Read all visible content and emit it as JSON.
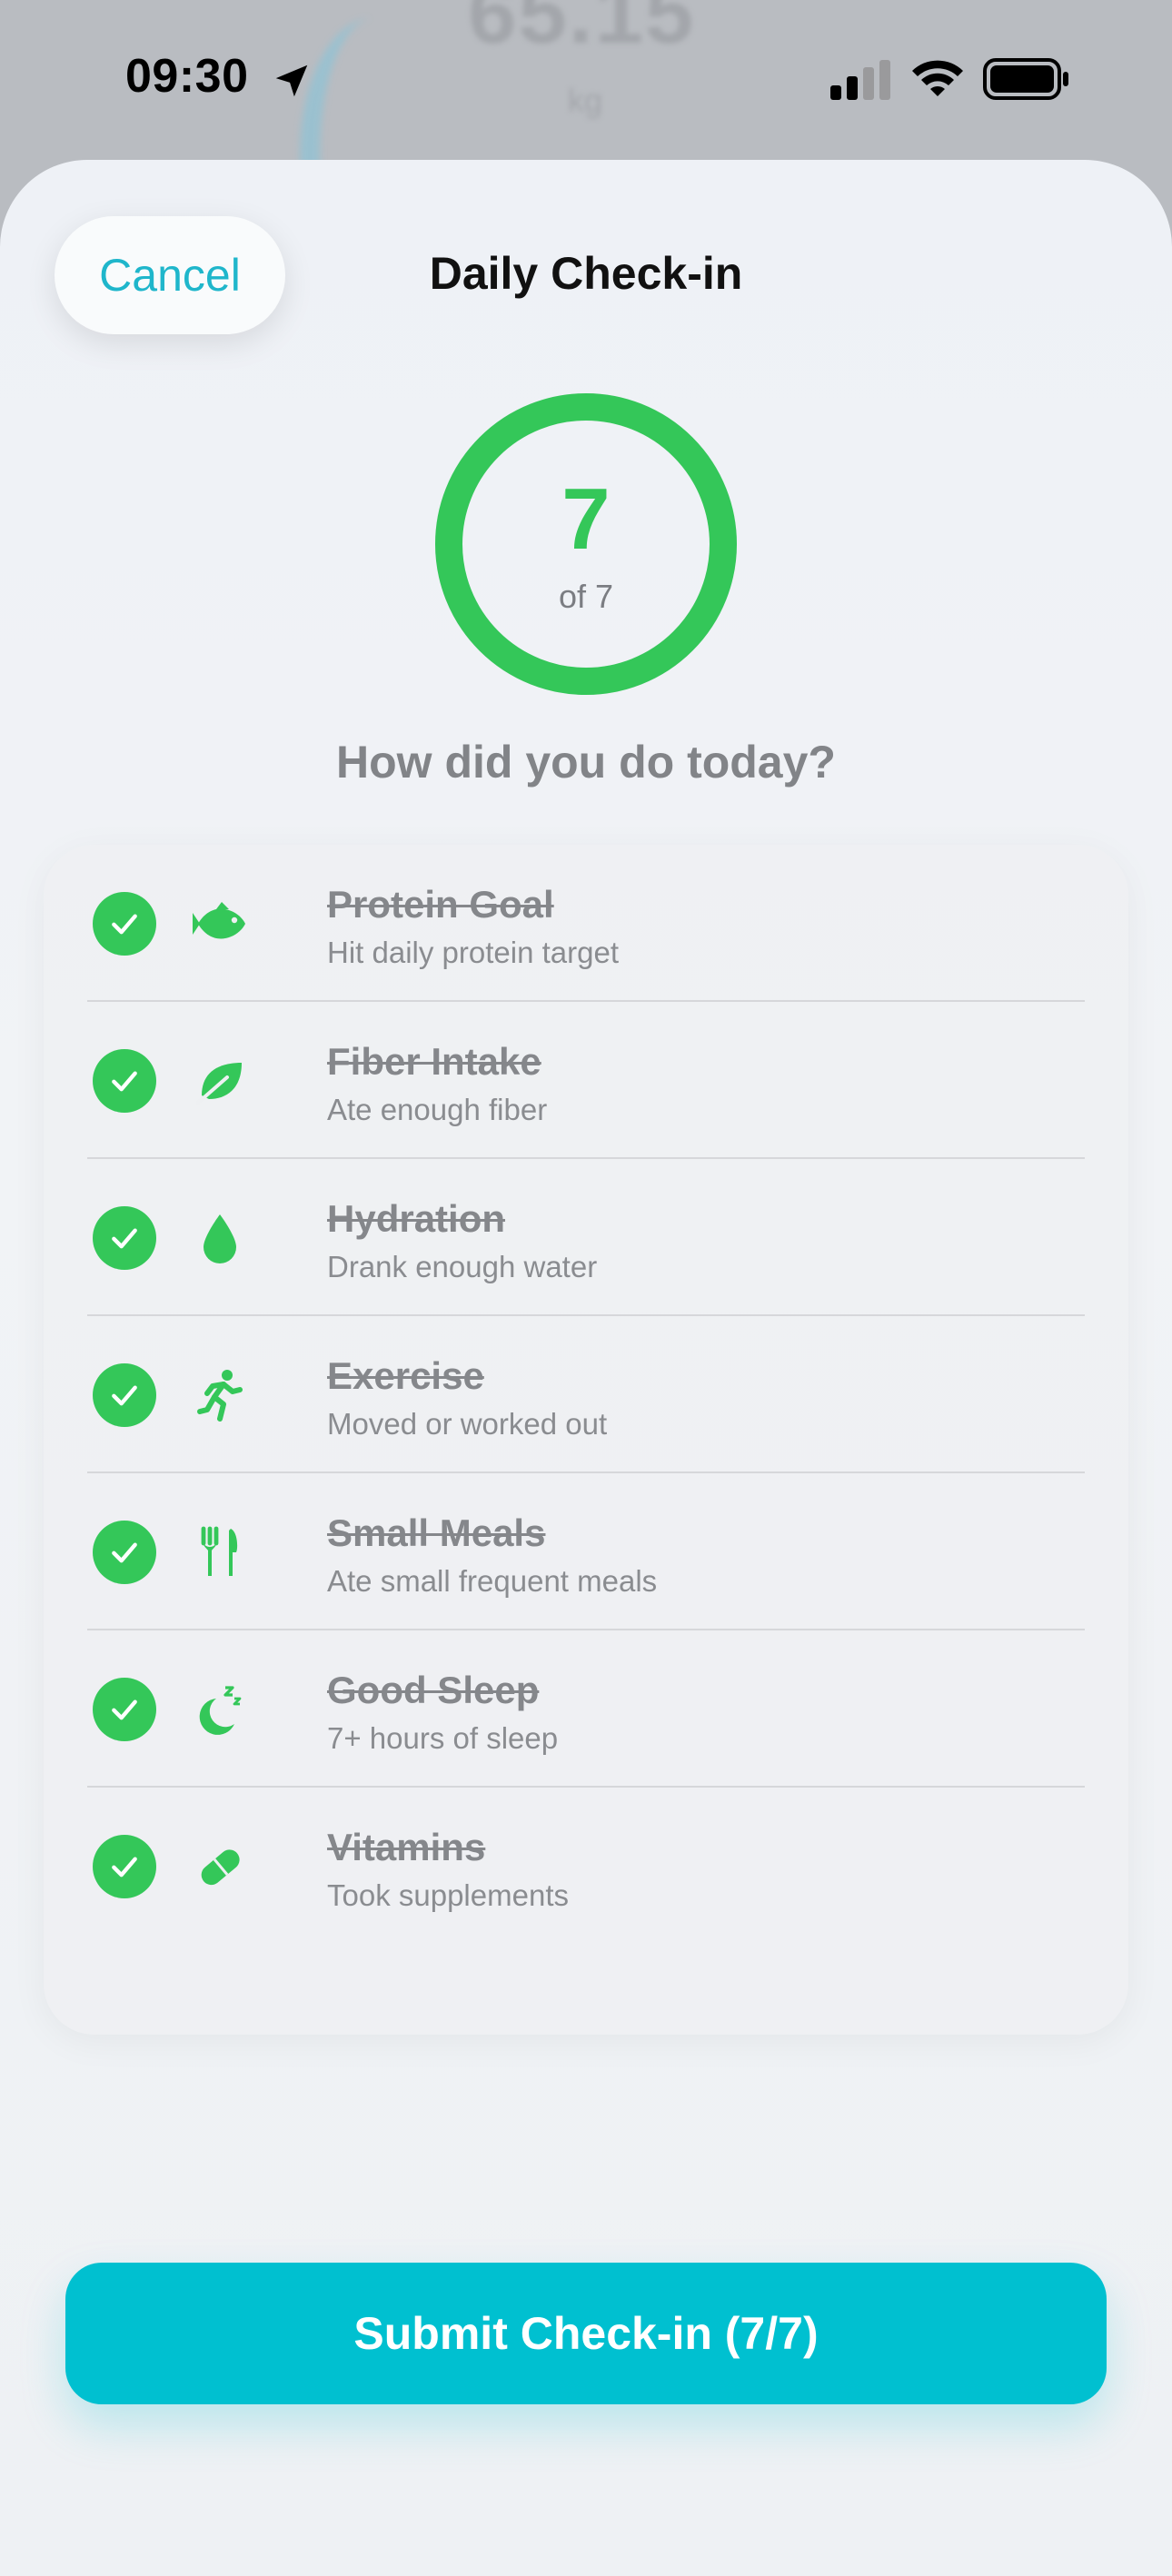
{
  "status_bar": {
    "time": "09:30",
    "icons": [
      "location-arrow-icon",
      "cellular-signal-icon",
      "wifi-icon",
      "battery-icon"
    ]
  },
  "background": {
    "value": "65.15",
    "unit": "kg"
  },
  "header": {
    "cancel_label": "Cancel",
    "title": "Daily Check-in"
  },
  "progress": {
    "completed": "7",
    "total_label": "of 7",
    "fraction": 1.0
  },
  "question": "How did you do today?",
  "checklist": {
    "items": [
      {
        "title": "Protein Goal",
        "subtitle": "Hit daily protein target",
        "icon": "fish-icon",
        "checked": true
      },
      {
        "title": "Fiber Intake",
        "subtitle": "Ate enough fiber",
        "icon": "leaf-icon",
        "checked": true
      },
      {
        "title": "Hydration",
        "subtitle": "Drank enough water",
        "icon": "water-drop-icon",
        "checked": true
      },
      {
        "title": "Exercise",
        "subtitle": "Moved or worked out",
        "icon": "running-figure-icon",
        "checked": true
      },
      {
        "title": "Small Meals",
        "subtitle": "Ate small frequent meals",
        "icon": "fork-knife-icon",
        "checked": true
      },
      {
        "title": "Good Sleep",
        "subtitle": "7+ hours of sleep",
        "icon": "moon-zzz-icon",
        "checked": true
      },
      {
        "title": "Vitamins",
        "subtitle": "Took supplements",
        "icon": "pill-icon",
        "checked": true
      }
    ]
  },
  "submit_label": "Submit Check-in (7/7)",
  "colors": {
    "accent": "#00c0d0",
    "cancel_text": "#1fb6cb",
    "success": "#34c759",
    "muted_text": "#85878b"
  }
}
